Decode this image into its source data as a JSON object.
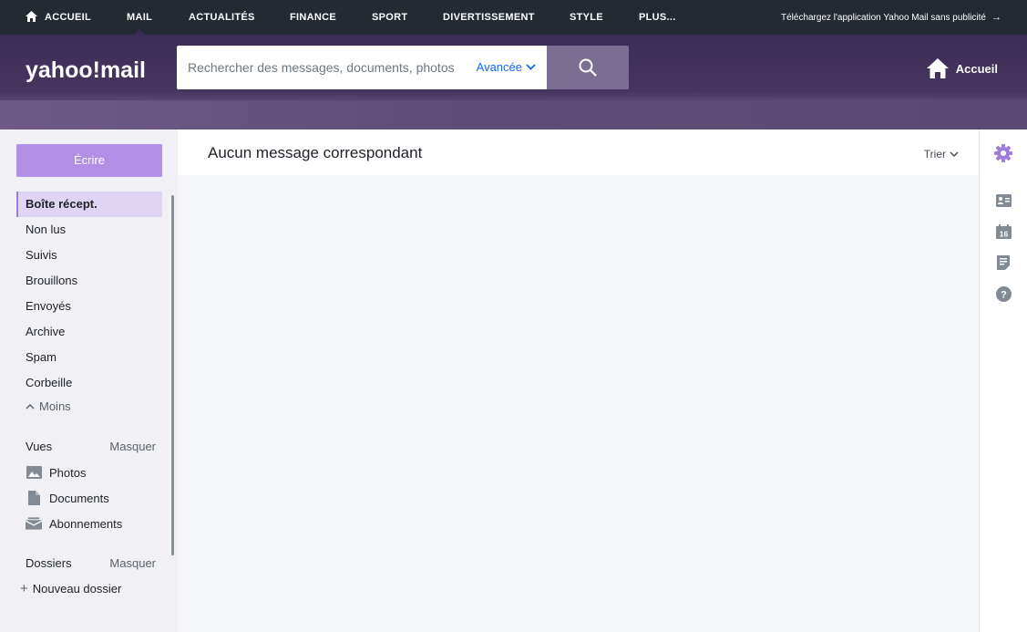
{
  "topnav": {
    "items": [
      {
        "label": "ACCUEIL",
        "icon": "home-icon"
      },
      {
        "label": "MAIL"
      },
      {
        "label": "ACTUALITÉS"
      },
      {
        "label": "FINANCE"
      },
      {
        "label": "SPORT"
      },
      {
        "label": "DIVERTISSEMENT"
      },
      {
        "label": "STYLE"
      },
      {
        "label": "PLUS..."
      }
    ],
    "active": "MAIL",
    "promo": "Téléchargez l'application Yahoo Mail sans publicité"
  },
  "header": {
    "logo": "yahoo!mail",
    "search_placeholder": "Rechercher des messages, documents, photos",
    "advanced_label": "Avancée",
    "home_label": "Accueil"
  },
  "sidebar": {
    "compose_label": "Écrire",
    "folders": [
      {
        "label": "Boîte récept."
      },
      {
        "label": "Non lus"
      },
      {
        "label": "Suivis"
      },
      {
        "label": "Brouillons"
      },
      {
        "label": "Envoyés"
      },
      {
        "label": "Archive"
      },
      {
        "label": "Spam"
      },
      {
        "label": "Corbeille"
      }
    ],
    "less_label": "Moins",
    "views": {
      "title": "Vues",
      "toggle": "Masquer",
      "items": [
        {
          "label": "Photos",
          "icon": "photo-icon"
        },
        {
          "label": "Documents",
          "icon": "document-icon"
        },
        {
          "label": "Abonnements",
          "icon": "subscriptions-icon"
        }
      ]
    },
    "folders_section": {
      "title": "Dossiers",
      "toggle": "Masquer",
      "new_folder": "Nouveau dossier"
    }
  },
  "main": {
    "empty_message": "Aucun message correspondant",
    "sort_label": "Trier"
  },
  "rail": {
    "icons": [
      "settings-icon",
      "contacts-icon",
      "calendar-icon",
      "notepad-icon",
      "help-icon"
    ],
    "calendar_day": "16"
  },
  "colors": {
    "topbar": "#232a31",
    "header": "#3b2d58",
    "accent": "#b08fe5",
    "link": "#0f69ff"
  }
}
